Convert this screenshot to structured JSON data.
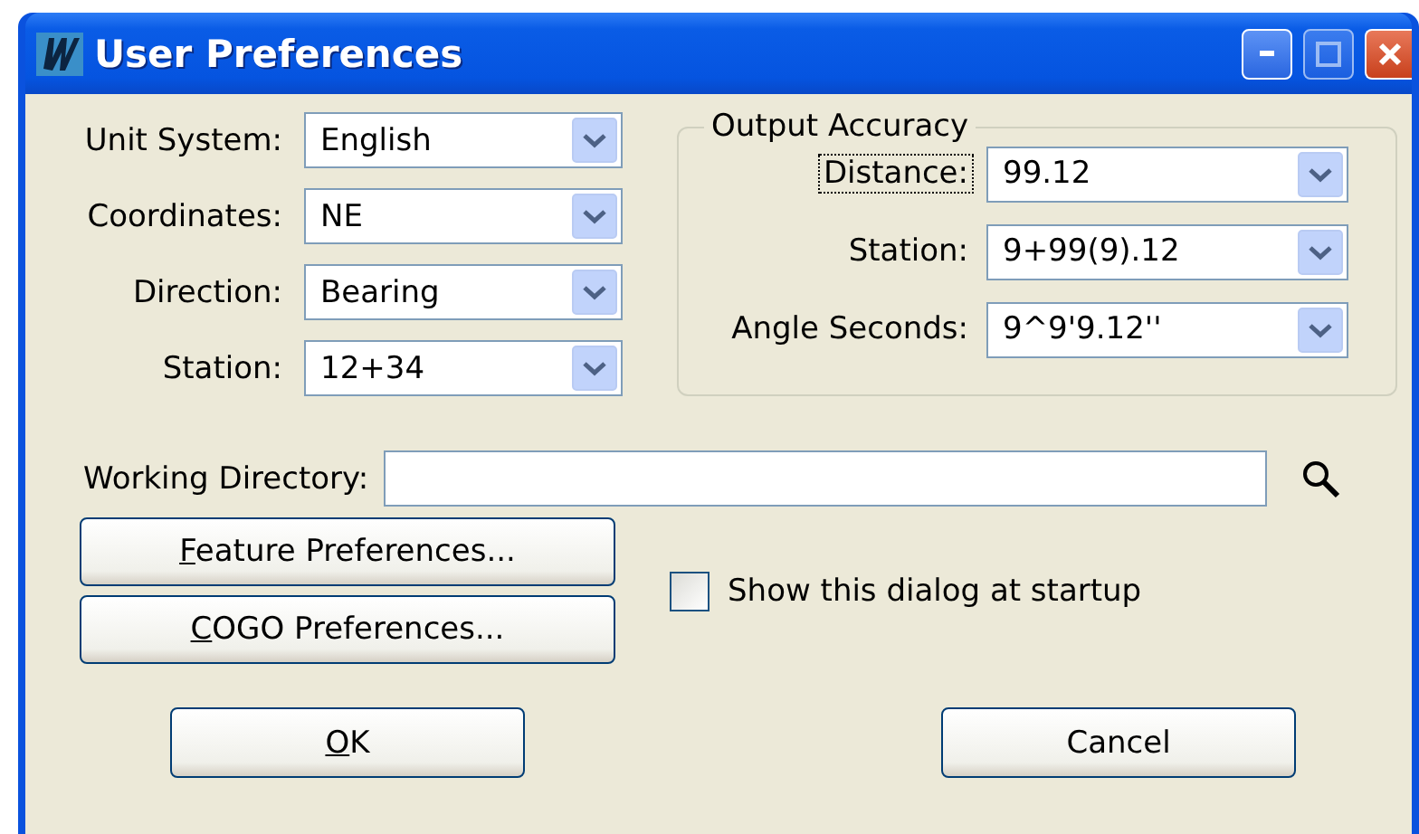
{
  "window": {
    "title": "User Preferences"
  },
  "fields": [
    {
      "label": "Unit System:",
      "value": "English"
    },
    {
      "label": "Coordinates:",
      "value": "NE"
    },
    {
      "label": "Direction:",
      "value": "Bearing"
    },
    {
      "label": "Station:",
      "value": "12+34"
    }
  ],
  "output_accuracy": {
    "title": "Output Accuracy",
    "fields": [
      {
        "label": "Distance:",
        "value": "99.12",
        "focused": true
      },
      {
        "label": "Station:",
        "value": "9+99(9).12",
        "focused": false
      },
      {
        "label": "Angle Seconds:",
        "value": "9^9'9.12''",
        "focused": false
      }
    ]
  },
  "working_directory": {
    "label": "Working Directory:"
  },
  "preference_buttons": [
    {
      "hotkey": "F",
      "rest": "eature Preferences..."
    },
    {
      "hotkey": "C",
      "rest": "OGO Preferences..."
    }
  ],
  "show_at_startup": {
    "label": "Show this dialog at startup",
    "checked": false
  },
  "dialog_buttons": [
    {
      "hotkey": "O",
      "rest": "K"
    },
    {
      "rest": "Cancel"
    }
  ]
}
